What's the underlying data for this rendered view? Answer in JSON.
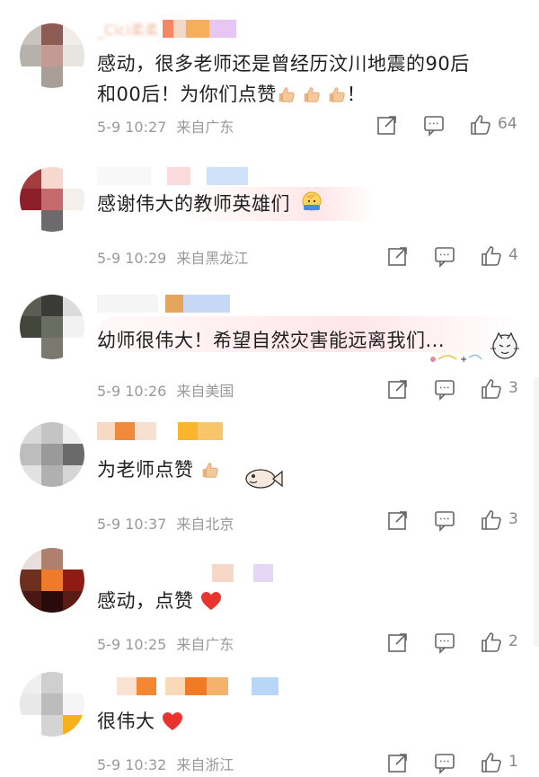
{
  "comments": [
    {
      "text_lines": [
        "感动，很多老师还是曾经历汶川地震的90后",
        "和00后！为你们点赞"
      ],
      "line2_suffix": "！",
      "username": "_Cici柔柔",
      "timestamp": "5-9 10:27",
      "location": "来自广东",
      "likes": "64"
    },
    {
      "text_lines": [
        "感谢伟大的教师英雄们"
      ],
      "timestamp": "5-9 10:29",
      "location": "来自黑龙江",
      "likes": "4"
    },
    {
      "text_lines": [
        "幼师很伟大！希望自然灾害能远离我们..."
      ],
      "timestamp": "5-9 10:26",
      "location": "来自美国",
      "likes": "3"
    },
    {
      "text_lines": [
        "为老师点赞"
      ],
      "timestamp": "5-9 10:37",
      "location": "来自北京",
      "likes": "3"
    },
    {
      "text_lines": [
        "感动，点赞"
      ],
      "timestamp": "5-9 10:25",
      "location": "来自广东",
      "likes": "2"
    },
    {
      "text_lines": [
        "很伟大"
      ],
      "timestamp": "5-9 10:32",
      "location": "来自浙江",
      "likes": "1"
    }
  ],
  "icons": {
    "share": "share-icon",
    "comment": "comment-icon",
    "like": "like-icon",
    "thumbs_emoji": "thumbs-up-emoji",
    "heart_emoji": "heart-emoji",
    "salute_emoji": "salute-emoji"
  },
  "colors": {
    "text": "#1f1f1f",
    "meta": "#999999",
    "heart": "#e8332e"
  }
}
